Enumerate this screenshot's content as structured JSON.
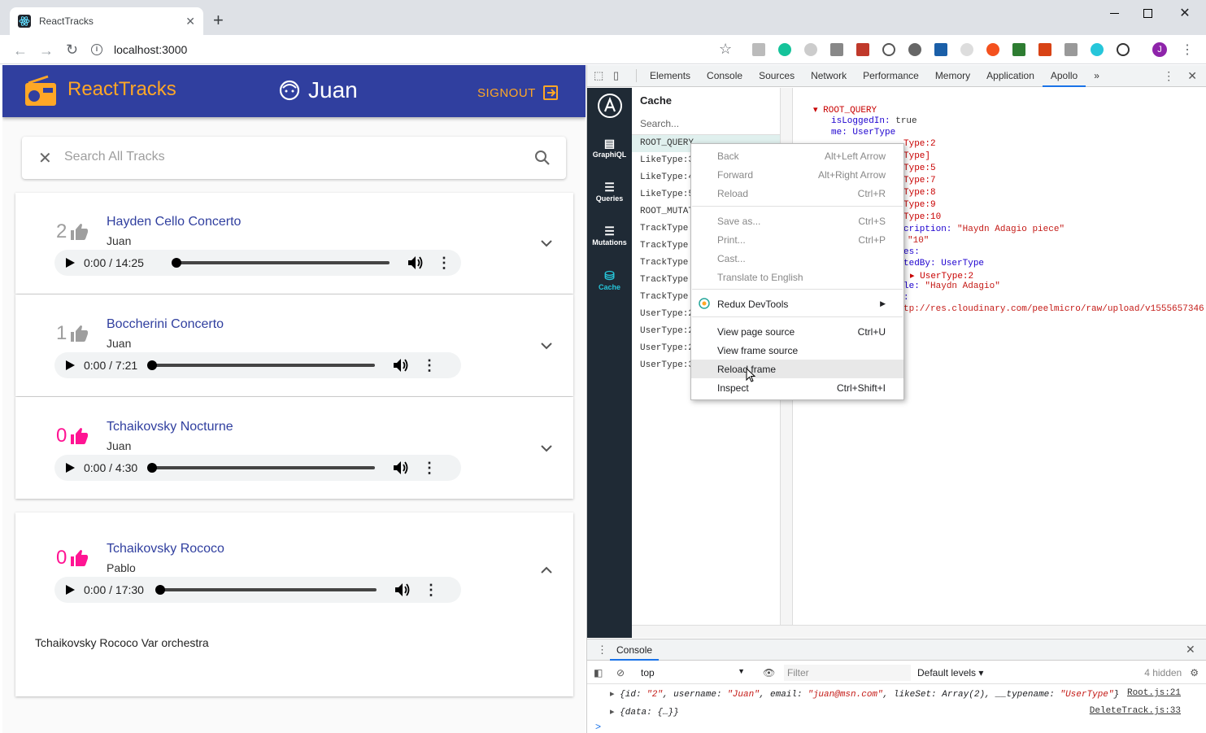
{
  "browser": {
    "tab_title": "ReactTracks",
    "new_tab": "+",
    "url": "localhost:3000",
    "profile_initial": "J",
    "window_controls": [
      "minimize",
      "maximize",
      "close"
    ]
  },
  "app": {
    "brand": "ReactTracks",
    "user_name": "Juan",
    "signout_label": "SIGNOUT",
    "search_placeholder": "Search All Tracks",
    "tracks": [
      {
        "likes": "2",
        "title": "Hayden Cello Concerto",
        "user": "Juan",
        "time": "0:00 / 14:25",
        "liked": false,
        "expanded": false
      },
      {
        "likes": "1",
        "title": "Boccherini Concerto",
        "user": "Juan",
        "time": "0:00 / 7:21",
        "liked": false,
        "expanded": false
      },
      {
        "likes": "0",
        "title": "Tchaikovsky Nocturne",
        "user": "Juan",
        "time": "0:00 / 4:30",
        "liked": true,
        "expanded": false
      },
      {
        "likes": "0",
        "title": "Tchaikovsky Rococo",
        "user": "Pablo",
        "time": "0:00 / 17:30",
        "liked": true,
        "expanded": true,
        "description": "Tchaikovsky Rococo Var orchestra"
      }
    ]
  },
  "devtools": {
    "tabs": [
      "Elements",
      "Console",
      "Sources",
      "Network",
      "Performance",
      "Memory",
      "Application",
      "Apollo"
    ],
    "active_tab": "Apollo",
    "more": "»",
    "apollo_nav": [
      "GraphiQL",
      "Queries",
      "Mutations",
      "Cache"
    ],
    "cache_title": "Cache",
    "cache_search": "Search...",
    "cache_items": [
      "ROOT_QUERY",
      "LikeType:3",
      "LikeType:4",
      "LikeType:5",
      "ROOT_MUTAT",
      "TrackType:",
      "TrackType:",
      "TrackType:",
      "TrackType:",
      "TrackType:",
      "UserType:2",
      "UserType:2",
      "UserType:2",
      "UserType:3"
    ],
    "details": {
      "root": "ROOT_QUERY",
      "isLoggedIn_key": "isLoggedIn:",
      "isLoggedIn_val": "true",
      "me_key": "me:",
      "me_val": "UserType",
      "partial_lines": [
        "Type:2",
        "Type]",
        "Type:5",
        "Type:7",
        "Type:8",
        "Type:9",
        "Type:10"
      ],
      "desc_key": "cription:",
      "desc_val": "\"Haydn Adagio piece\"",
      "id_val": "\"10\"",
      "likes_key": "es:",
      "postedby_key": "tedBy:",
      "postedby_val": "UserType",
      "usertype_ref": "UserType:2",
      "title_key": "le:",
      "title_val": "\"Haydn Adagio\"",
      "url_key": ":",
      "url_val": "tp://res.cloudinary.com/peelmicro/raw/upload/v1555657346"
    },
    "console": {
      "tab": "Console",
      "context": "top",
      "filter_placeholder": "Filter",
      "levels": "Default levels",
      "hidden": "4 hidden",
      "lines": [
        {
          "text_prefix": "{id: ",
          "id": "\"2\"",
          "mid1": ", username: ",
          "username": "\"Juan\"",
          "mid2": ", email: ",
          "email": "\"juan@msn.com\"",
          "mid3": ", likeSet: Array(2), __typename: ",
          "typename": "\"UserType\"",
          "suffix": "}",
          "source": "Root.js:21"
        },
        {
          "text": "{data: {…}}",
          "source": "DeleteTrack.js:33"
        }
      ],
      "prompt": ">"
    }
  },
  "context_menu": {
    "items": [
      {
        "label": "Back",
        "shortcut": "Alt+Left Arrow",
        "disabled": true
      },
      {
        "label": "Forward",
        "shortcut": "Alt+Right Arrow",
        "disabled": true
      },
      {
        "label": "Reload",
        "shortcut": "Ctrl+R",
        "disabled": true
      },
      {
        "label": "Save as...",
        "shortcut": "Ctrl+S",
        "disabled": true
      },
      {
        "label": "Print...",
        "shortcut": "Ctrl+P",
        "disabled": true
      },
      {
        "label": "Cast...",
        "shortcut": "",
        "disabled": true
      },
      {
        "label": "Translate to English",
        "shortcut": "",
        "disabled": true
      },
      {
        "label": "Redux DevTools",
        "shortcut": "",
        "disabled": false
      },
      {
        "label": "View page source",
        "shortcut": "Ctrl+U",
        "disabled": false
      },
      {
        "label": "View frame source",
        "shortcut": "",
        "disabled": false
      },
      {
        "label": "Reload frame",
        "shortcut": "",
        "disabled": false,
        "hover": true
      },
      {
        "label": "Inspect",
        "shortcut": "Ctrl+Shift+I",
        "disabled": false
      }
    ]
  },
  "colors": {
    "appbar": "#303f9f",
    "accent_orange": "#ffa726",
    "liked_pink": "#ff1493",
    "apollo_sidebar": "#1f2a35"
  }
}
